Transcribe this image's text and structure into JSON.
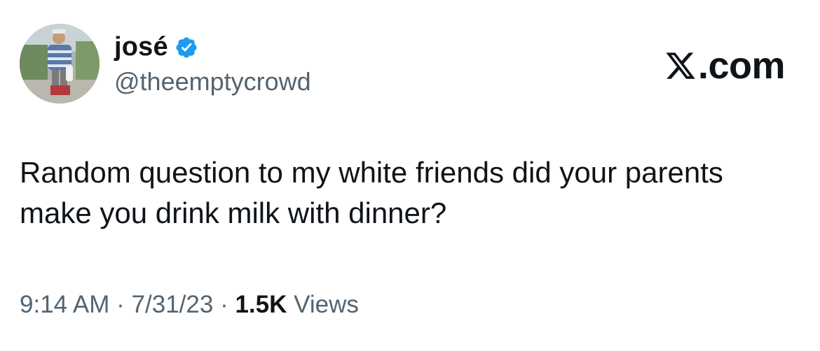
{
  "author": {
    "display_name": "josé",
    "handle": "@theemptycrowd",
    "verified": true,
    "verified_color": "#1d9bf0"
  },
  "brand": {
    "label": ".com",
    "icon": "x-logo-icon"
  },
  "tweet": {
    "text": "Random question to my white friends did your parents make you drink milk with dinner?"
  },
  "meta": {
    "time": "9:14 AM",
    "separator": "·",
    "date": "7/31/23",
    "views_count": "1.5K",
    "views_label": "Views"
  },
  "colors": {
    "text_primary": "#0f1419",
    "text_secondary": "#536471",
    "background": "#ffffff"
  }
}
